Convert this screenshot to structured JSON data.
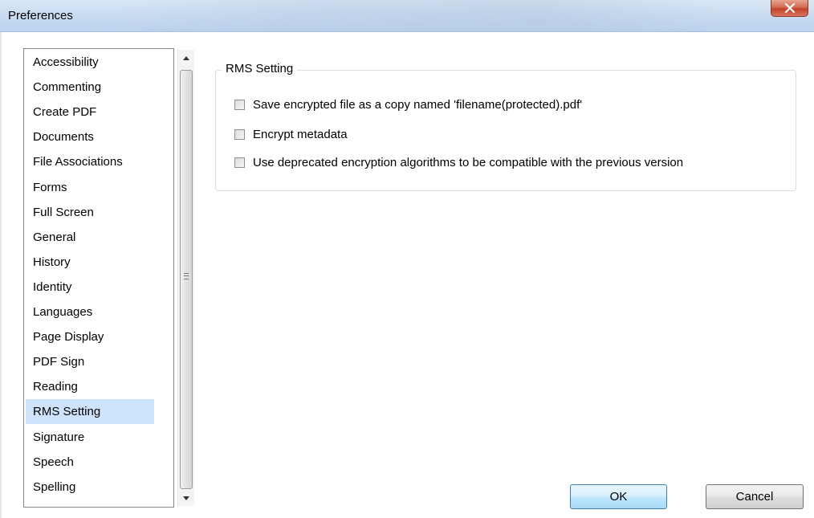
{
  "window": {
    "title": "Preferences",
    "close_label": "X"
  },
  "sidebar": {
    "items": [
      {
        "label": "Accessibility",
        "selected": false
      },
      {
        "label": "Commenting",
        "selected": false
      },
      {
        "label": "Create PDF",
        "selected": false
      },
      {
        "label": "Documents",
        "selected": false
      },
      {
        "label": "File Associations",
        "selected": false
      },
      {
        "label": "Forms",
        "selected": false
      },
      {
        "label": "Full Screen",
        "selected": false
      },
      {
        "label": "General",
        "selected": false
      },
      {
        "label": "History",
        "selected": false
      },
      {
        "label": "Identity",
        "selected": false
      },
      {
        "label": "Languages",
        "selected": false
      },
      {
        "label": "Page Display",
        "selected": false
      },
      {
        "label": "PDF Sign",
        "selected": false
      },
      {
        "label": "Reading",
        "selected": false
      },
      {
        "label": "RMS Setting",
        "selected": true
      },
      {
        "label": "Signature",
        "selected": false
      },
      {
        "label": "Speech",
        "selected": false
      },
      {
        "label": "Spelling",
        "selected": false
      }
    ]
  },
  "rms_settings": {
    "group_title": "RMS Setting",
    "options": [
      {
        "label": "Save encrypted file as a copy named 'filename(protected).pdf'",
        "checked": false
      },
      {
        "label": "Encrypt metadata",
        "checked": false
      },
      {
        "label": "Use deprecated encryption algorithms to be compatible with the previous version",
        "checked": false
      }
    ]
  },
  "buttons": {
    "ok_label": "OK",
    "cancel_label": "Cancel"
  },
  "colors": {
    "selection": "#cde3fb",
    "close_button": "#c4412a",
    "ok_border": "#3c7fb1"
  }
}
